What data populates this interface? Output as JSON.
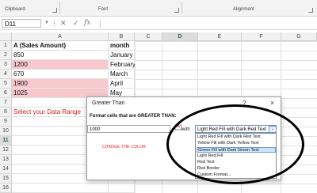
{
  "ribbon": {
    "groups": [
      "Clipboard",
      "Font",
      "Alignment"
    ]
  },
  "formula_bar": {
    "name_box": "D11",
    "cancel_icon": "close-icon",
    "enter_icon": "checkmark-icon",
    "function_label": "fx",
    "formula": ""
  },
  "sheet": {
    "columns": [
      "A",
      "B",
      "C",
      "D",
      "E",
      "F",
      "G"
    ],
    "selected_column": "D",
    "selected_row": "11",
    "rows": [
      {
        "num": "1",
        "a": "A (Sales Amount)",
        "b": "month"
      },
      {
        "num": "2",
        "a": "850",
        "b": "January"
      },
      {
        "num": "3",
        "a": "1200",
        "b": "February"
      },
      {
        "num": "4",
        "a": "670",
        "b": "March"
      },
      {
        "num": "5",
        "a": "1900",
        "b": "April"
      },
      {
        "num": "6",
        "a": "1025",
        "b": "May"
      },
      {
        "num": "7",
        "a": "",
        "b": ""
      },
      {
        "num": "8",
        "a": "Select your Data Range",
        "b": ""
      },
      {
        "num": "9",
        "a": "",
        "b": ""
      },
      {
        "num": "10",
        "a": "",
        "b": ""
      },
      {
        "num": "11",
        "a": "",
        "b": ""
      },
      {
        "num": "12",
        "a": "",
        "b": ""
      },
      {
        "num": "13",
        "a": "",
        "b": ""
      },
      {
        "num": "14",
        "a": "",
        "b": ""
      },
      {
        "num": "15",
        "a": "",
        "b": ""
      },
      {
        "num": "16",
        "a": "",
        "b": ""
      }
    ],
    "highlight_color": "#f7c8cc",
    "note_color": "#e02020"
  },
  "dialog": {
    "title": "Greater Than",
    "help": "?",
    "close": "×",
    "prompt": "Format cells that are GREATER THAN:",
    "value": "1000",
    "with_label": "with",
    "selected_format": "Light Red Fill with Dark Red Text",
    "note": "CHANGE THE COLOR",
    "options": [
      "Light Red Fill with Dark Red Text",
      "Yellow Fill with Dark Yellow Text",
      "Green Fill with Dark Green Text",
      "Light Red Fill",
      "Red Text",
      "Red Border",
      "Custom Format..."
    ],
    "highlighted_option": 2
  }
}
